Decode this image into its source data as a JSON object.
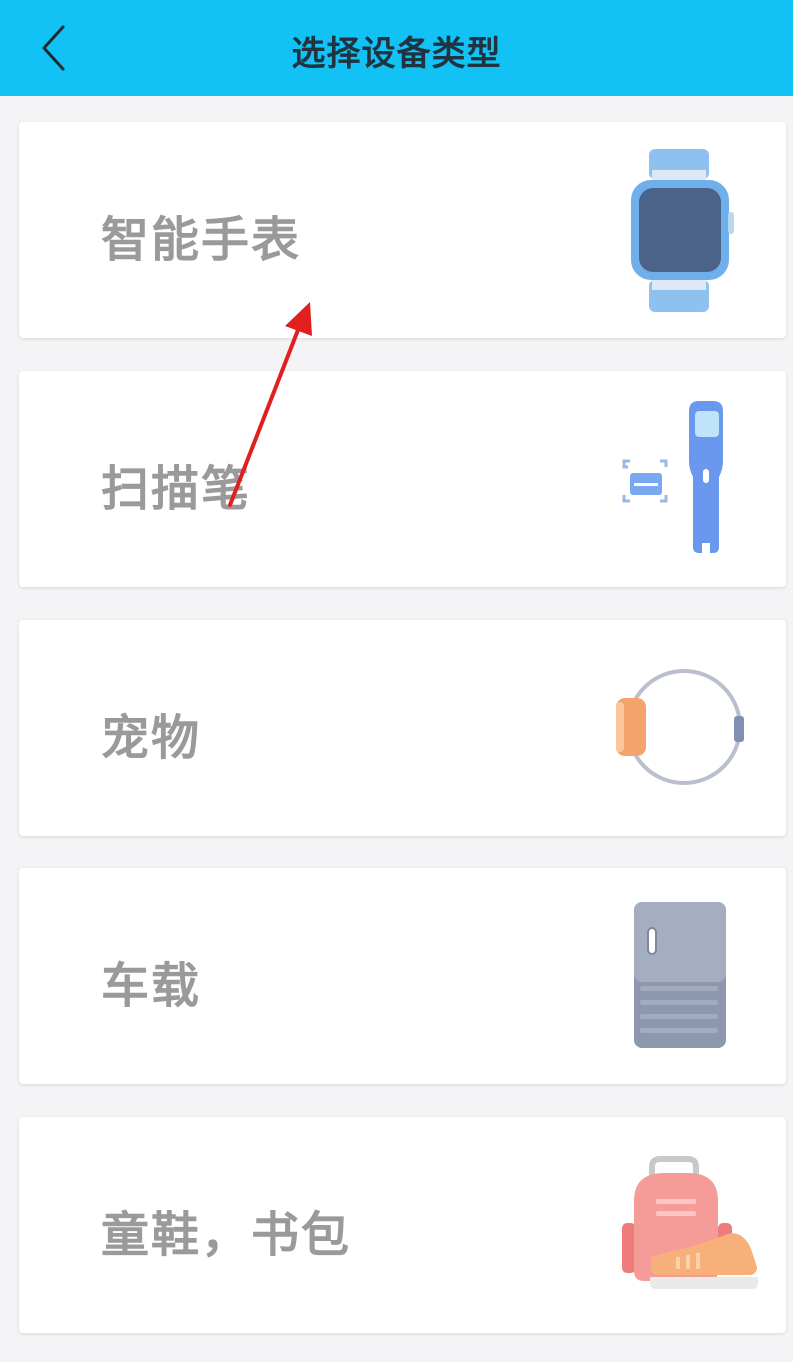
{
  "header": {
    "title": "选择设备类型",
    "back_icon": "chevron-left-icon",
    "background": "#12c2f4"
  },
  "devices": [
    {
      "label": "智能手表",
      "icon": "smartwatch-icon"
    },
    {
      "label": "扫描笔",
      "icon": "scan-pen-icon"
    },
    {
      "label": "宠物",
      "icon": "pet-collar-icon"
    },
    {
      "label": "车载",
      "icon": "car-device-icon"
    },
    {
      "label": "童鞋，书包",
      "icon": "backpack-shoe-icon"
    }
  ],
  "annotation": {
    "type": "red-arrow",
    "color": "#e02020"
  }
}
